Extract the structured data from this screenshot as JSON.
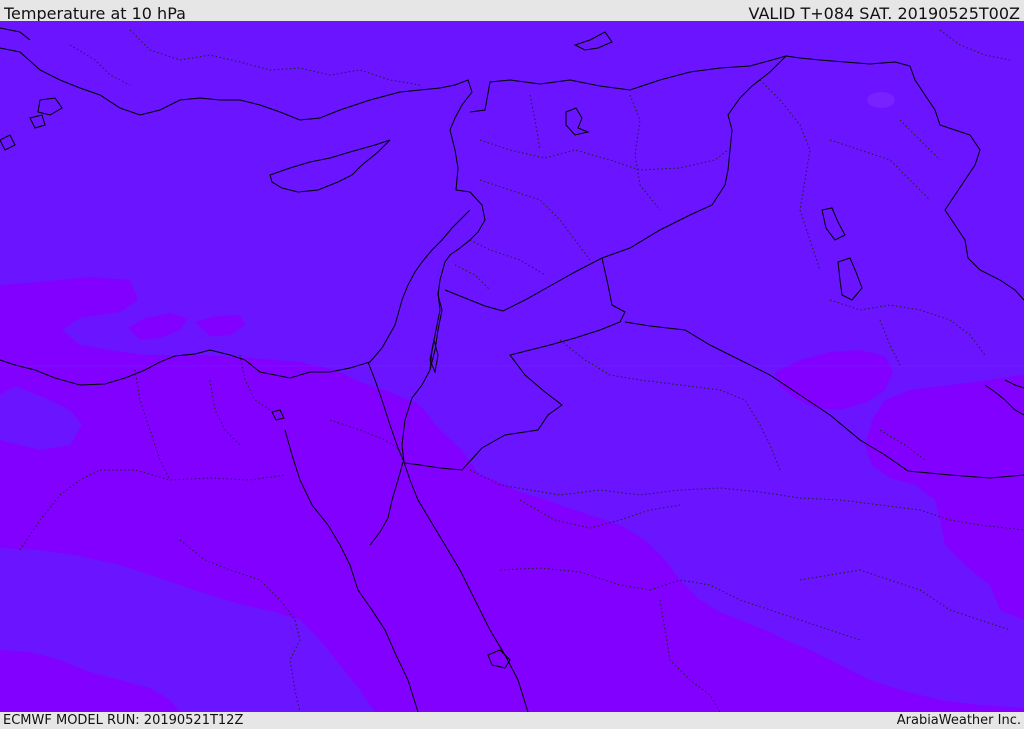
{
  "header": {
    "title": "Temperature at 10 hPa",
    "valid": "VALID T+084 SAT. 20190525T00Z"
  },
  "footer": {
    "model_run": "ECMWF MODEL RUN: 20190521T12Z",
    "credit": "ArabiaWeather Inc."
  },
  "colors": {
    "band_cool": "#6a14ff",
    "band_warm": "#8200ff",
    "coastline": "#000000",
    "border": "#000000",
    "province_border": "#222222",
    "bar_background": "#e6e6e6"
  }
}
